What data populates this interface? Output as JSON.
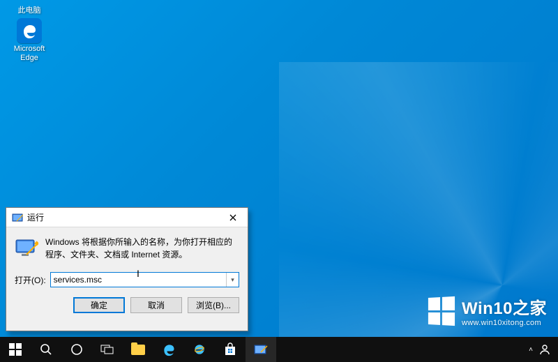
{
  "desktop": {
    "icons": {
      "this_pc": "此电脑",
      "edge": "Microsoft Edge"
    }
  },
  "run_dialog": {
    "title": "运行",
    "description": "Windows 将根据你所输入的名称，为你打开相应的程序、文件夹、文档或 Internet 资源。",
    "open_label": "打开(O):",
    "open_value": "services.msc",
    "buttons": {
      "ok": "确定",
      "cancel": "取消",
      "browse": "浏览(B)..."
    }
  },
  "watermark": {
    "title": "Win10之家",
    "url": "www.win10xitong.com"
  },
  "colors": {
    "accent": "#0078d7",
    "desktop_bg": "#0099e6",
    "taskbar_bg": "#101010"
  }
}
